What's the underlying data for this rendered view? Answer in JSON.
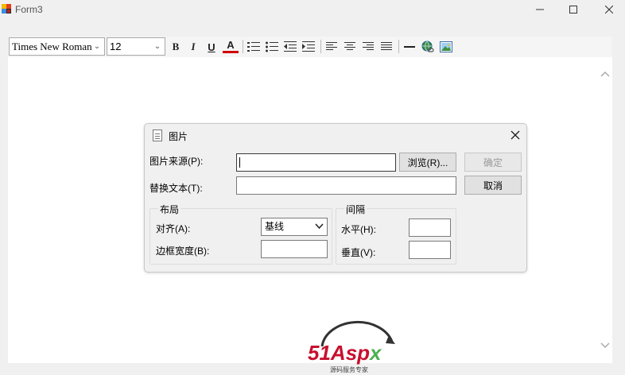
{
  "window": {
    "title": "Form3"
  },
  "toolbar": {
    "font_family": "Times New Roman",
    "font_size": "12",
    "bold": "B",
    "italic": "I",
    "underline": "U",
    "font_color": "A"
  },
  "dialog": {
    "title": "图片",
    "image_source_label": "图片来源(P):",
    "image_source_value": "",
    "browse_label": "浏览(R)...",
    "ok_label": "确定",
    "cancel_label": "取消",
    "alt_text_label": "替换文本(T):",
    "alt_text_value": "",
    "layout": {
      "title": "布局",
      "align_label": "对齐(A):",
      "align_value": "基线",
      "border_label": "边框宽度(B):",
      "border_value": ""
    },
    "spacing": {
      "title": "间隔",
      "horizontal_label": "水平(H):",
      "horizontal_value": "",
      "vertical_label": "垂直(V):",
      "vertical_value": ""
    }
  },
  "watermark": {
    "brand": "51Aspx",
    "tagline": "源码服务专家"
  },
  "colors": {
    "accent": "#c8102e",
    "green": "#4caf50"
  }
}
